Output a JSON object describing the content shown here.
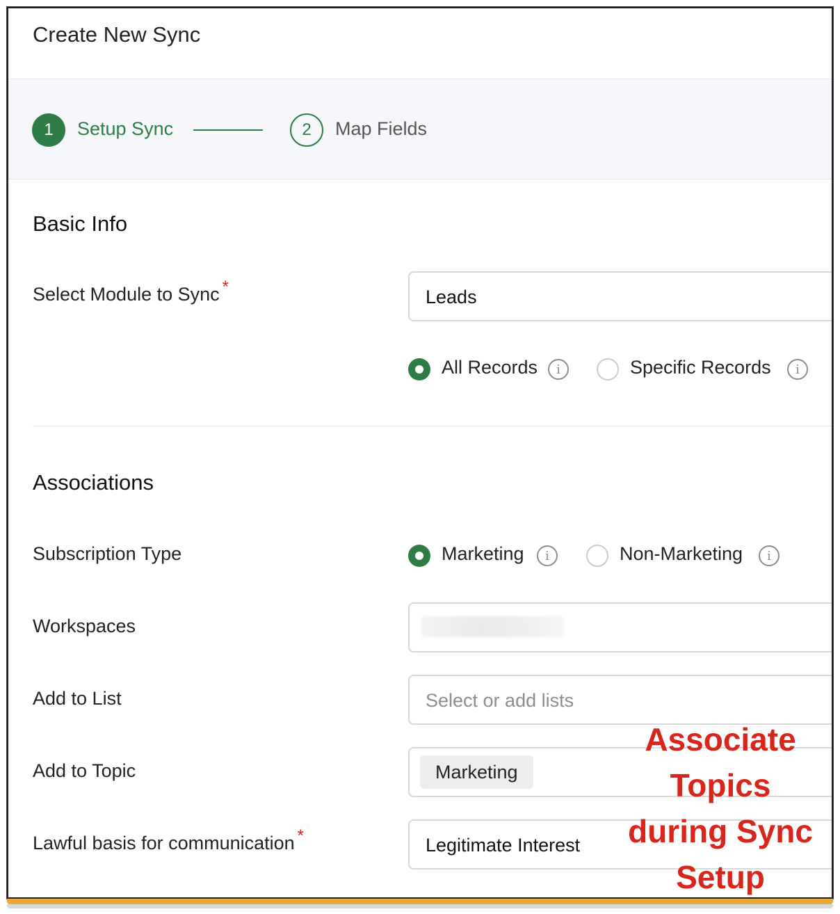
{
  "header": {
    "title": "Create New Sync"
  },
  "stepper": {
    "steps": [
      {
        "number": "1",
        "label": "Setup Sync"
      },
      {
        "number": "2",
        "label": "Map Fields"
      }
    ]
  },
  "basic_info": {
    "title": "Basic Info",
    "module_label": "Select Module to Sync",
    "required_mark": "*",
    "module_value": "Leads",
    "record_options": [
      {
        "label": "All Records",
        "selected": true
      },
      {
        "label": "Specific Records",
        "selected": false
      }
    ]
  },
  "associations": {
    "title": "Associations",
    "subscription_label": "Subscription Type",
    "subscription_options": [
      {
        "label": "Marketing",
        "selected": true
      },
      {
        "label": "Non-Marketing",
        "selected": false
      }
    ],
    "workspaces_label": "Workspaces",
    "add_to_list_label": "Add to List",
    "add_to_list_placeholder": "Select or add lists",
    "add_to_topic_label": "Add to Topic",
    "topic_tag": "Marketing",
    "lawful_basis_label": "Lawful basis for communication",
    "lawful_basis_value": "Legitimate Interest"
  },
  "annotation": {
    "lines": [
      "Associate",
      "Topics",
      "during Sync",
      "Setup"
    ]
  },
  "colors": {
    "accent": "#2e7d46",
    "required": "#d9261c",
    "annotation": "#d9261c"
  },
  "icons": {
    "info": "info-icon"
  }
}
